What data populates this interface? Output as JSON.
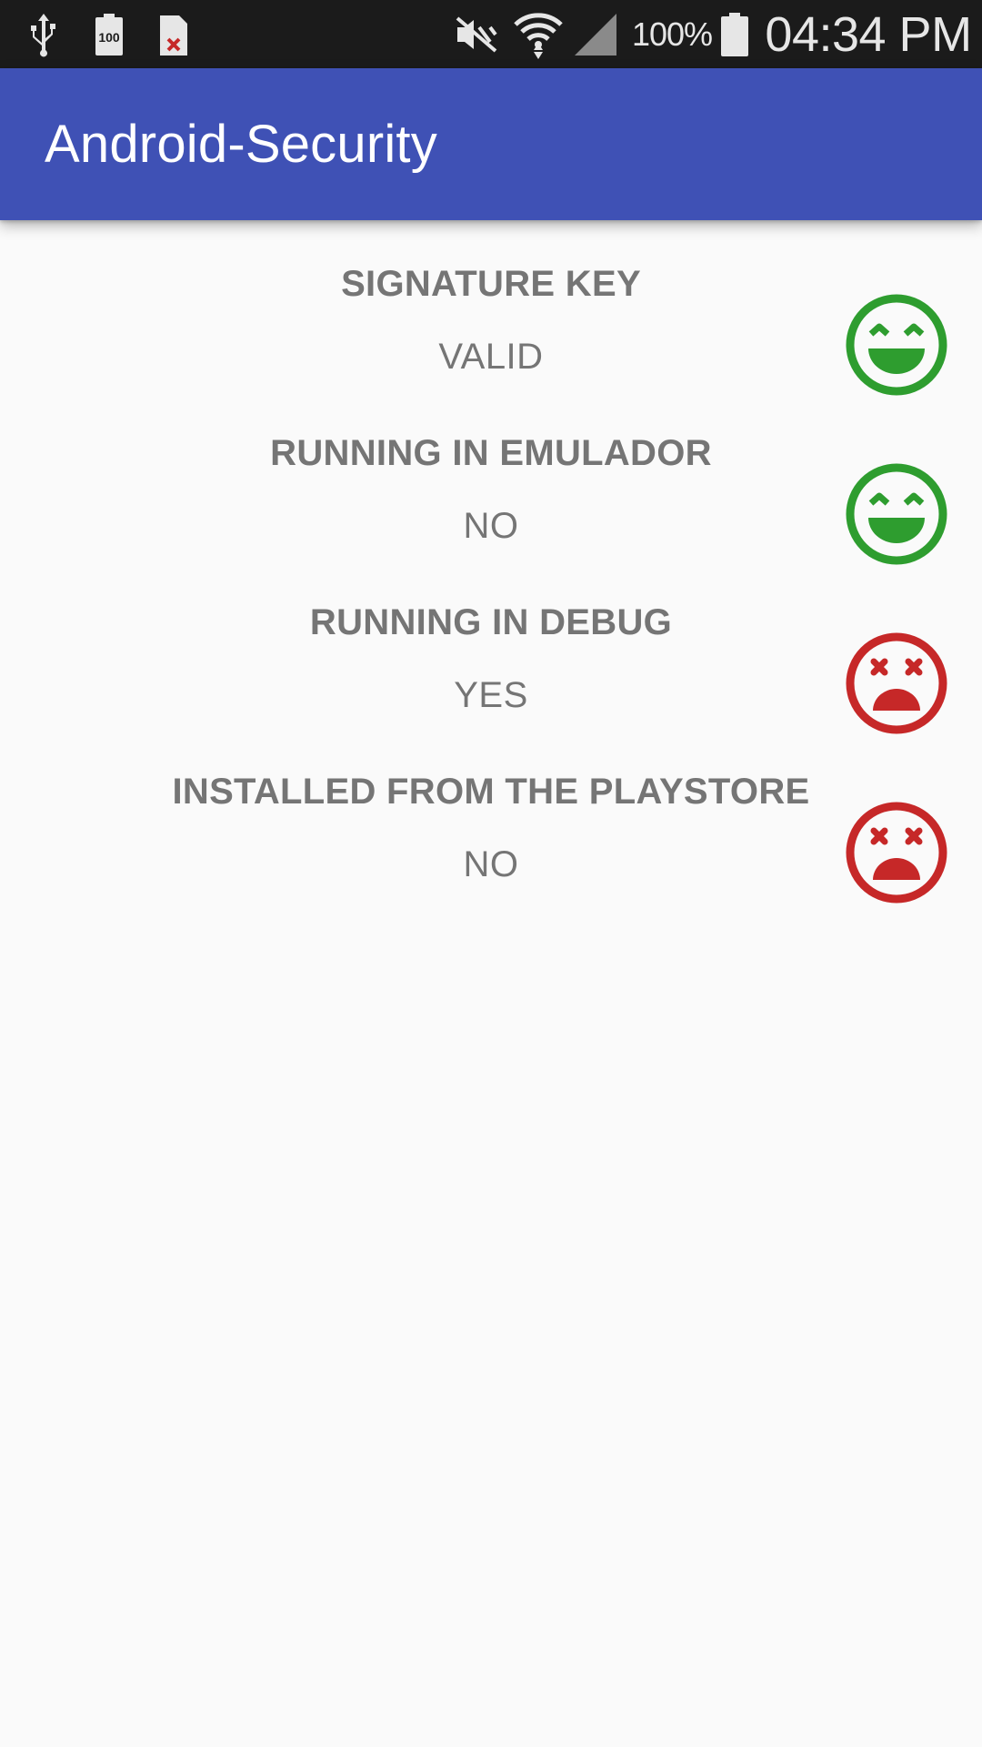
{
  "status_bar": {
    "battery_percent": "100%",
    "time": "04:34 PM",
    "icons": [
      "usb-icon",
      "battery-100-icon",
      "no-sim-icon",
      "vibrate-mute-icon",
      "wifi-icon",
      "cell-signal-icon",
      "battery-icon"
    ],
    "text_color": "#e6e6e6",
    "background": "#1b1b1b"
  },
  "app_bar": {
    "title": "Android-Security",
    "background": "#3f51b5"
  },
  "checks": [
    {
      "label": "SIGNATURE KEY",
      "value": "VALID",
      "status": "ok",
      "icon": "happy-face-icon"
    },
    {
      "label": "RUNNING IN EMULADOR",
      "value": "NO",
      "status": "ok",
      "icon": "happy-face-icon"
    },
    {
      "label": "RUNNING IN DEBUG",
      "value": "YES",
      "status": "fail",
      "icon": "sad-face-icon"
    },
    {
      "label": "INSTALLED FROM THE PLAYSTORE",
      "value": "NO",
      "status": "fail",
      "icon": "sad-face-icon"
    }
  ],
  "colors": {
    "ok": "#2e9d2f",
    "fail": "#c62828",
    "text": "#757575",
    "background": "#fafafa"
  }
}
